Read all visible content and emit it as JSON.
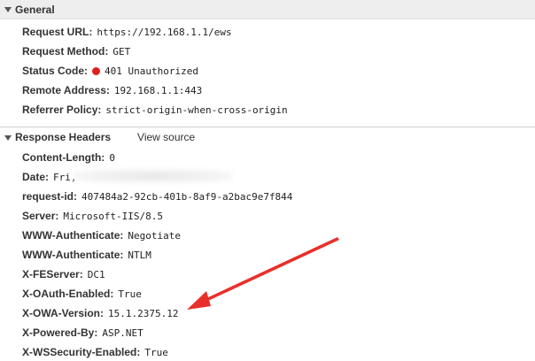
{
  "general": {
    "title": "General",
    "rows": [
      {
        "key": "Request URL:",
        "value": "https://192.168.1.1/ews"
      },
      {
        "key": "Request Method:",
        "value": "GET"
      },
      {
        "key": "Status Code:",
        "value": "401 Unauthorized"
      },
      {
        "key": "Remote Address:",
        "value": "192.168.1.1:443"
      },
      {
        "key": "Referrer Policy:",
        "value": "strict-origin-when-cross-origin"
      }
    ]
  },
  "response_headers": {
    "title": "Response Headers",
    "view_source": "View source",
    "rows": [
      {
        "key": "Content-Length:",
        "value": "0"
      },
      {
        "key": "Date:",
        "value": "Fri,"
      },
      {
        "key": "request-id:",
        "value": "407484a2-92cb-401b-8af9-a2bac9e7f844"
      },
      {
        "key": "Server:",
        "value": "Microsoft-IIS/8.5"
      },
      {
        "key": "WWW-Authenticate:",
        "value": "Negotiate"
      },
      {
        "key": "WWW-Authenticate:",
        "value": "NTLM"
      },
      {
        "key": "X-FEServer:",
        "value": "DC1"
      },
      {
        "key": "X-OAuth-Enabled:",
        "value": "True"
      },
      {
        "key": "X-OWA-Version:",
        "value": "15.1.2375.12"
      },
      {
        "key": "X-Powered-By:",
        "value": "ASP.NET"
      },
      {
        "key": "X-WSSecurity-Enabled:",
        "value": "True"
      }
    ]
  },
  "colors": {
    "status_dot": "#e0201b",
    "annotation_arrow": "#e8302a",
    "header_bg": "#eeeeee"
  },
  "icons": {
    "section_toggle": "triangle-down-icon",
    "status": "red-dot-icon",
    "annotation": "arrow-icon"
  }
}
